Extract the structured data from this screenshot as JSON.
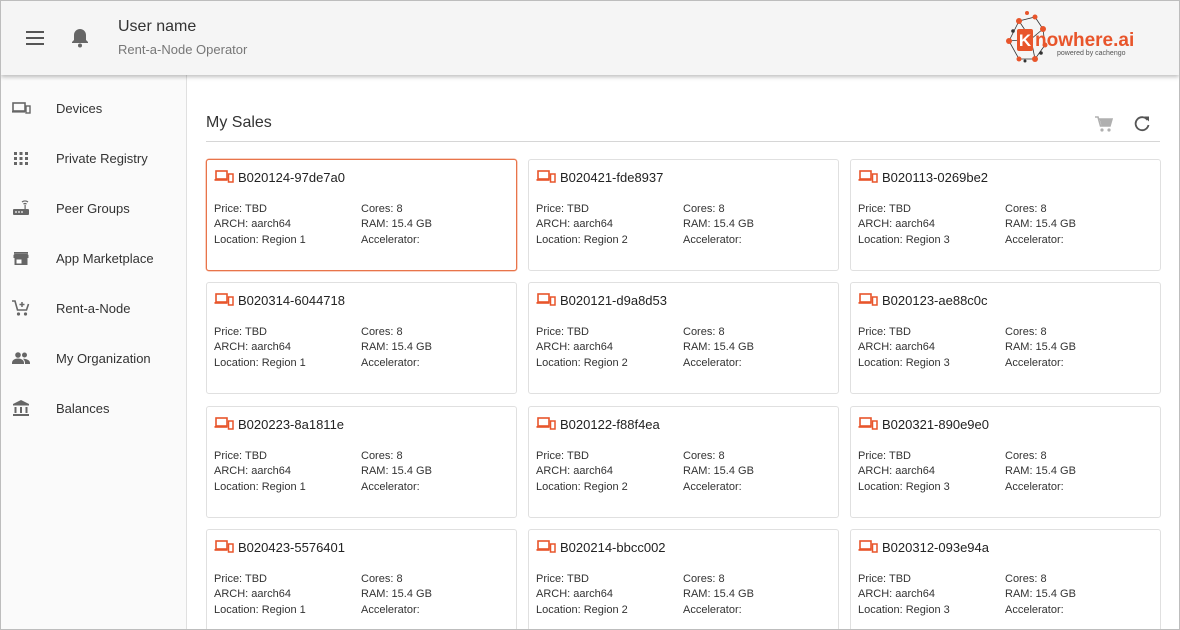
{
  "header": {
    "user_name": "User name",
    "user_role": "Rent-a-Node Operator",
    "logo_text_k": "K",
    "logo_text_rest": "nowhere.ai",
    "logo_tagline": "powered by cachengo",
    "accent_color": "#e8552b"
  },
  "sidebar": {
    "items": [
      {
        "label": "Devices",
        "icon": "devices-icon"
      },
      {
        "label": "Private Registry",
        "icon": "apps-grid-icon"
      },
      {
        "label": "Peer Groups",
        "icon": "router-icon"
      },
      {
        "label": "App Marketplace",
        "icon": "store-icon"
      },
      {
        "label": "Rent-a-Node",
        "icon": "cart-add-icon"
      },
      {
        "label": "My Organization",
        "icon": "people-icon"
      },
      {
        "label": "Balances",
        "icon": "bank-icon"
      }
    ]
  },
  "main": {
    "title": "My Sales",
    "toolbar": {
      "cart_icon": "cart-icon",
      "refresh_icon": "refresh-icon"
    },
    "cards": [
      {
        "id": "B020124-97de7a0",
        "price": "Price: TBD",
        "arch": "ARCH: aarch64",
        "location": "Location: Region 1",
        "cores": "Cores: 8",
        "ram": "RAM: 15.4 GB",
        "accel": "Accelerator:",
        "selected": true
      },
      {
        "id": "B020421-fde8937",
        "price": "Price: TBD",
        "arch": "ARCH: aarch64",
        "location": "Location: Region 2",
        "cores": "Cores: 8",
        "ram": "RAM: 15.4 GB",
        "accel": "Accelerator:"
      },
      {
        "id": "B020113-0269be2",
        "price": "Price: TBD",
        "arch": "ARCH: aarch64",
        "location": "Location: Region 3",
        "cores": "Cores: 8",
        "ram": "RAM: 15.4 GB",
        "accel": "Accelerator:"
      },
      {
        "id": "B020314-6044718",
        "price": "Price: TBD",
        "arch": "ARCH: aarch64",
        "location": "Location: Region 1",
        "cores": "Cores: 8",
        "ram": "RAM: 15.4 GB",
        "accel": "Accelerator:"
      },
      {
        "id": "B020121-d9a8d53",
        "price": "Price: TBD",
        "arch": "ARCH: aarch64",
        "location": "Location: Region 2",
        "cores": "Cores: 8",
        "ram": "RAM: 15.4 GB",
        "accel": "Accelerator:"
      },
      {
        "id": "B020123-ae88c0c",
        "price": "Price: TBD",
        "arch": "ARCH: aarch64",
        "location": "Location: Region 3",
        "cores": "Cores: 8",
        "ram": "RAM: 15.4 GB",
        "accel": "Accelerator:"
      },
      {
        "id": "B020223-8a1811e",
        "price": "Price: TBD",
        "arch": "ARCH: aarch64",
        "location": "Location: Region 1",
        "cores": "Cores: 8",
        "ram": "RAM: 15.4 GB",
        "accel": "Accelerator:"
      },
      {
        "id": "B020122-f88f4ea",
        "price": "Price: TBD",
        "arch": "ARCH: aarch64",
        "location": "Location: Region 2",
        "cores": "Cores: 8",
        "ram": "RAM: 15.4 GB",
        "accel": "Accelerator:"
      },
      {
        "id": "B020321-890e9e0",
        "price": "Price: TBD",
        "arch": "ARCH: aarch64",
        "location": "Location: Region 3",
        "cores": "Cores: 8",
        "ram": "RAM: 15.4 GB",
        "accel": "Accelerator:"
      },
      {
        "id": "B020423-5576401",
        "price": "Price: TBD",
        "arch": "ARCH: aarch64",
        "location": "Location: Region 1",
        "cores": "Cores: 8",
        "ram": "RAM: 15.4 GB",
        "accel": "Accelerator:"
      },
      {
        "id": "B020214-bbcc002",
        "price": "Price: TBD",
        "arch": "ARCH: aarch64",
        "location": "Location: Region 2",
        "cores": "Cores: 8",
        "ram": "RAM: 15.4 GB",
        "accel": "Accelerator:"
      },
      {
        "id": "B020312-093e94a",
        "price": "Price: TBD",
        "arch": "ARCH: aarch64",
        "location": "Location: Region 3",
        "cores": "Cores: 8",
        "ram": "RAM: 15.4 GB",
        "accel": "Accelerator:"
      }
    ]
  }
}
